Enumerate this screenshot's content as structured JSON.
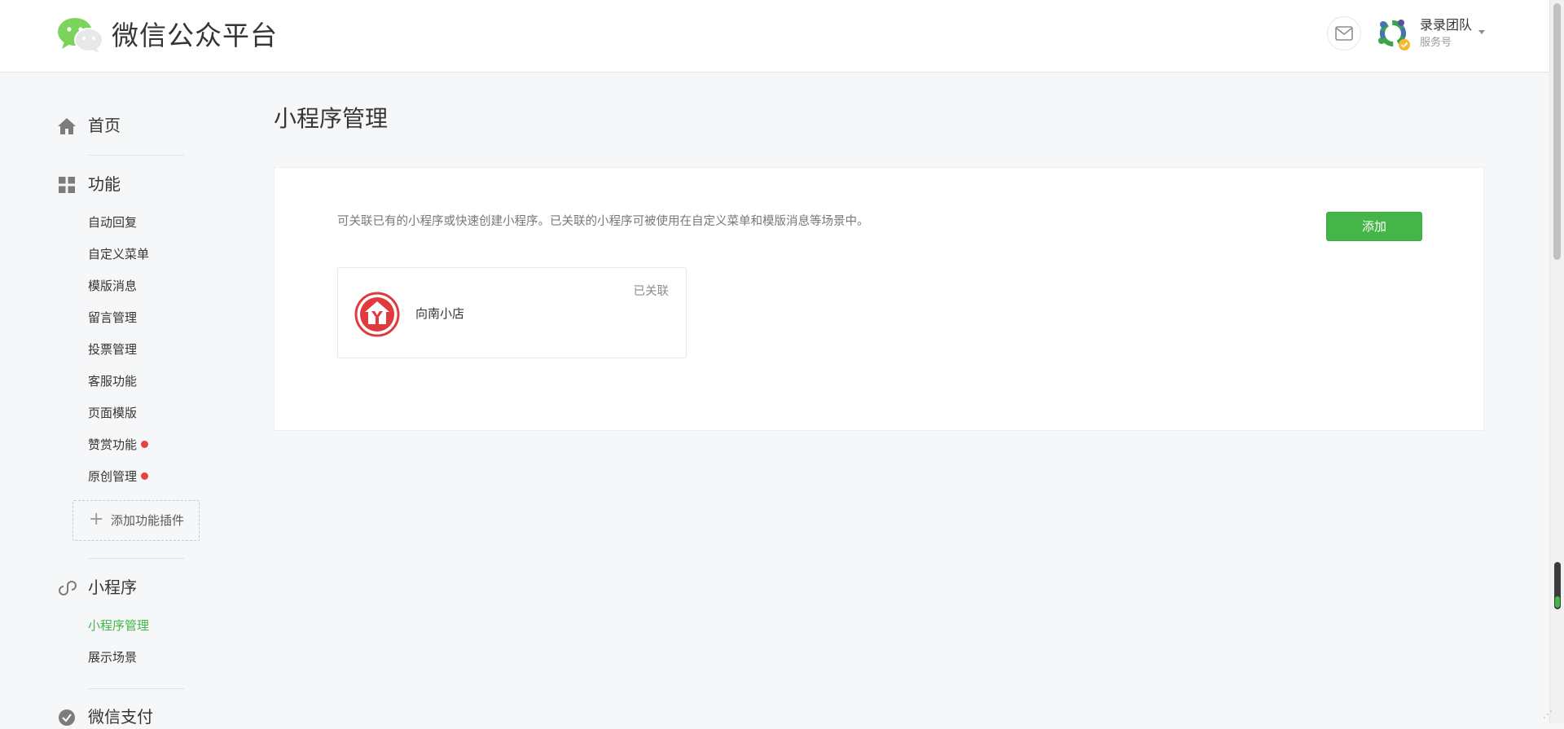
{
  "header": {
    "logo_icon": "wechat-logo-icon",
    "title": "微信公众平台",
    "mail_icon": "mail-icon",
    "account": {
      "name": "录录团队",
      "type": "服务号"
    }
  },
  "sidebar": {
    "home": {
      "label": "首页",
      "icon": "home-icon"
    },
    "features": {
      "label": "功能",
      "icon": "grid-icon",
      "items": [
        {
          "label": "自动回复",
          "dot": false
        },
        {
          "label": "自定义菜单",
          "dot": false
        },
        {
          "label": "模版消息",
          "dot": false
        },
        {
          "label": "留言管理",
          "dot": false
        },
        {
          "label": "投票管理",
          "dot": false
        },
        {
          "label": "客服功能",
          "dot": false
        },
        {
          "label": "页面模版",
          "dot": false
        },
        {
          "label": "赞赏功能",
          "dot": true
        },
        {
          "label": "原创管理",
          "dot": true
        }
      ],
      "add_plugin": "添加功能插件"
    },
    "miniprogram": {
      "label": "小程序",
      "icon": "link-icon",
      "items": [
        {
          "label": "小程序管理",
          "active": true
        },
        {
          "label": "展示场景",
          "active": false
        }
      ]
    },
    "pay": {
      "label": "微信支付",
      "icon": "check-circle-icon"
    }
  },
  "main": {
    "title": "小程序管理",
    "description": "可关联已有的小程序或快速创建小程序。已关联的小程序可被使用在自定义菜单和模版消息等场景中。",
    "add_button": "添加",
    "cards": [
      {
        "name": "向南小店",
        "status": "已关联",
        "logo_icon": "shop-logo-icon"
      }
    ]
  },
  "colors": {
    "accent": "#44b549",
    "alert_dot": "#e64340",
    "background": "#f6f7f9",
    "shop_logo": "#e0393e"
  }
}
